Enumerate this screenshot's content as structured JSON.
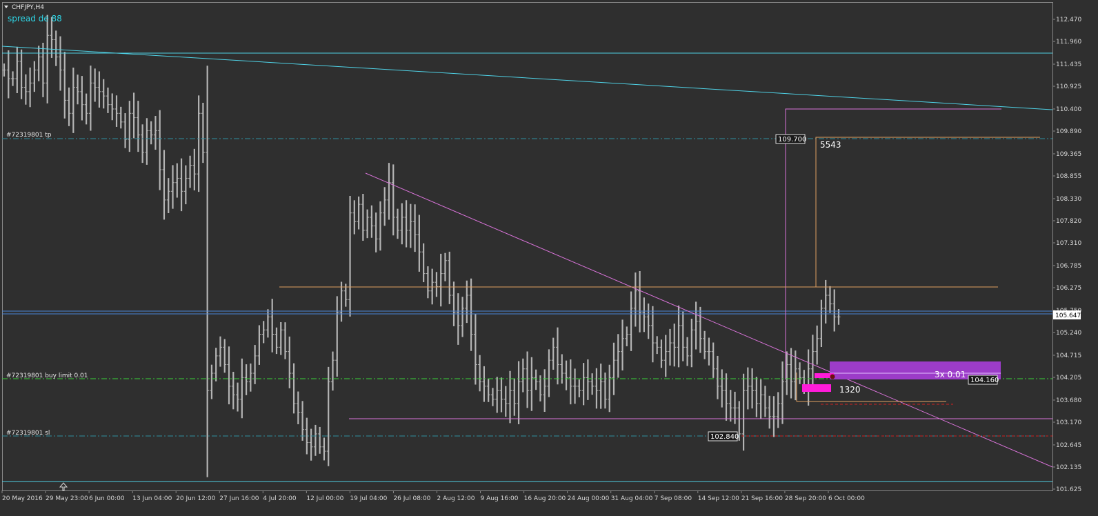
{
  "header": {
    "symbol_label": "CHFJPY,H4",
    "spread_label": "spread de 88"
  },
  "colors": {
    "background": "#2f2f2f",
    "candles": "#b4b4b4",
    "axis_text": "#d8d8d8",
    "cyan_line": "#4fd2e6",
    "magenta_line": "#d873d8",
    "orange_line": "#e0a060",
    "green_level": "#3ad23a",
    "teal_level": "#2f8f9f",
    "red_level": "#d02020",
    "purple_box": "#9c3cc8",
    "magenta_box": "#ff1bd9",
    "blue_band": "#4a84d8"
  },
  "orders": {
    "tp_label": "#72319801 tp",
    "buy_limit_label": "#72319801 buy limit 0.01",
    "sl_label": "#72319801 sl"
  },
  "annotations": {
    "top_price_box": "109.700",
    "top_count": "5543",
    "low_price_box": "102.840",
    "mid_count": "1320",
    "position_label": "3x 0.01",
    "position_price_box": "104.160"
  },
  "chart_data": {
    "type": "candlestick",
    "symbol": "CHFJPY",
    "timeframe": "H4",
    "ylim": [
      101.625,
      112.47
    ],
    "y_ticks": [
      "112.470",
      "111.960",
      "111.435",
      "110.925",
      "110.400",
      "109.890",
      "109.365",
      "108.855",
      "108.330",
      "107.820",
      "107.310",
      "106.785",
      "106.275",
      "105.750",
      "105.240",
      "104.715",
      "104.205",
      "103.680",
      "103.170",
      "102.645",
      "102.135",
      "101.625"
    ],
    "current_price": "105.647",
    "x_ticks": [
      "20 May 2016",
      "29 May 23:00",
      "6 Jun 00:00",
      "13 Jun 04:00",
      "20 Jun 12:00",
      "27 Jun 16:00",
      "4 Jul 20:00",
      "12 Jul 00:00",
      "19 Jul 04:00",
      "26 Jul 08:00",
      "2 Aug 12:00",
      "9 Aug 16:00",
      "16 Aug 20:00",
      "24 Aug 00:00",
      "31 Aug 04:00",
      "7 Sep 08:00",
      "14 Sep 12:00",
      "21 Sep 16:00",
      "28 Sep 20:00",
      "6 Oct 00:00"
    ],
    "closes": [
      111.3,
      111.1,
      111.1,
      111.5,
      110.9,
      110.8,
      111.0,
      111.3,
      111.6,
      111.0,
      112.1,
      112.0,
      111.6,
      111.3,
      110.6,
      110.3,
      110.9,
      110.8,
      110.5,
      110.3,
      111.0,
      110.9,
      110.8,
      110.7,
      110.5,
      110.4,
      110.3,
      110.1,
      109.7,
      110.3,
      110.2,
      109.8,
      109.4,
      109.9,
      109.8,
      109.9,
      109.0,
      108.3,
      108.5,
      108.7,
      108.8,
      108.5,
      108.8,
      109.1,
      108.9,
      110.3,
      109.4,
      103.9,
      104.3,
      104.7,
      104.9,
      104.5,
      104.0,
      103.8,
      103.7,
      104.2,
      104.1,
      104.3,
      104.7,
      105.2,
      105.3,
      105.6,
      105.2,
      104.9,
      105.3,
      104.8,
      104.3,
      103.6,
      103.4,
      103.0,
      102.7,
      102.6,
      102.9,
      102.6,
      102.5,
      104.1,
      104.6,
      105.7,
      106.2,
      106.0,
      108.0,
      107.8,
      108.2,
      107.6,
      107.9,
      107.7,
      107.4,
      108.0,
      108.3,
      108.7,
      107.9,
      107.6,
      107.9,
      107.6,
      107.8,
      107.5,
      107.1,
      106.6,
      106.2,
      106.4,
      106.3,
      106.6,
      106.9,
      106.1,
      105.7,
      105.4,
      105.8,
      106.1,
      105.2,
      104.5,
      104.1,
      104.0,
      103.8,
      103.7,
      103.9,
      103.7,
      103.6,
      103.9,
      103.6,
      104.1,
      104.4,
      103.9,
      104.2,
      104.1,
      103.8,
      104.0,
      104.6,
      104.9,
      104.5,
      104.3,
      104.2,
      104.0,
      104.0,
      103.9,
      104.2,
      104.1,
      104.0,
      103.9,
      104.1,
      103.7,
      104.2,
      104.6,
      104.8,
      105.1,
      105.2,
      105.8,
      106.2,
      105.7,
      105.6,
      105.4,
      105.0,
      104.9,
      104.6,
      104.8,
      105.0,
      104.9,
      105.4,
      104.9,
      104.7,
      105.3,
      105.5,
      105.1,
      104.8,
      104.8,
      104.4,
      104.0,
      103.9,
      103.6,
      103.5,
      103.5,
      102.9,
      103.9,
      104.0,
      103.9,
      103.6,
      103.8,
      103.5,
      103.3,
      103.3,
      103.6,
      104.1,
      104.5,
      104.1,
      104.4,
      104.2,
      104.0,
      104.4,
      104.8,
      105.1,
      105.8,
      106.1,
      105.9,
      105.6,
      105.6
    ]
  }
}
